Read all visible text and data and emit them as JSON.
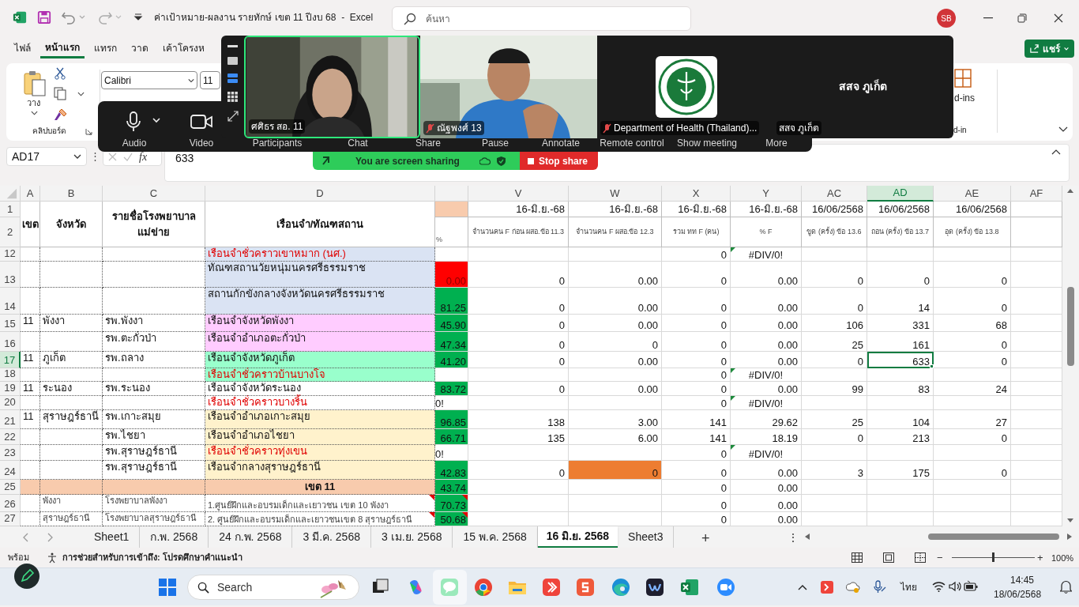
{
  "title_bar": {
    "title": "ค่าเป้าหมาย-ผลงาน รายทักษ์ เขต 11 ปีงบ 68  -  Excel",
    "search_placeholder": "ค้นหา",
    "avatar": "SB"
  },
  "ribbon_tabs": [
    {
      "label": "ไฟล์",
      "selected": false
    },
    {
      "label": "หน้าแรก",
      "selected": true
    },
    {
      "label": "แทรก",
      "selected": false
    },
    {
      "label": "วาด",
      "selected": false
    },
    {
      "label": "เค้าโครงห",
      "selected": false
    }
  ],
  "share_button": "แชร์",
  "ribbon": {
    "paste": "วาง",
    "clipboard_group": "คลิปบอร์ด",
    "font": "Calibri",
    "font_size": "11",
    "addins": "d-ins",
    "addins_group": "d-in"
  },
  "formula_bar": {
    "name_box": "AD17",
    "more": "⋮",
    "fx": "fx",
    "value": "633"
  },
  "sheet": {
    "columns": [
      {
        "letter": "A",
        "selected": false
      },
      {
        "letter": "B",
        "selected": false
      },
      {
        "letter": "C",
        "selected": false
      },
      {
        "letter": "D",
        "selected": false
      },
      {
        "selected": false
      },
      {
        "letter": "V",
        "selected": false
      },
      {
        "letter": "W",
        "selected": false
      },
      {
        "letter": "X",
        "selected": false
      },
      {
        "letter": "Y",
        "selected": false
      },
      {
        "letter": "AC",
        "selected": false
      },
      {
        "letter": "AD",
        "selected": true
      },
      {
        "letter": "AE",
        "selected": false
      },
      {
        "letter": "AF",
        "selected": false
      }
    ],
    "header_rows": [
      "1",
      "2"
    ],
    "left_headers": [
      "เขต",
      "จังหวัด",
      "รายชื่อโรงพยาบาลแม่ข่าย",
      "เรือนจำ/ทัณฑสถาน"
    ],
    "percent_header": {
      "color": "#f8cbad",
      "label": "%"
    },
    "dates": [
      "16-มิ.ย.-68",
      "16-มิ.ย.-68",
      "16-มิ.ย.-68",
      "16-มิ.ย.-68",
      "16/06/2568",
      "16/06/2568",
      "16/06/2568"
    ],
    "labels": [
      "จำนวนคน F ก่อน ผสอ.ข้อ 11.3",
      "จำนวนคน F ผสอ.ข้อ 12.3",
      "รวม ทท F (คน)",
      "% F",
      "ขูด (ครั้ง) ข้อ 13.6",
      "ถอน (ครั้ง) ข้อ 13.7",
      "อุด (ครั้ง) ข้อ 13.8"
    ],
    "rows": [
      {
        "row": "12",
        "kind": "entry",
        "selected": false,
        "prison": "เรือนจำชั่วคราวเขาหมาก (นศ.)",
        "color": "#dae3f3",
        "alert": true,
        "error_flag": true,
        "comment": false,
        "values": [
          {
            "selected": false
          },
          {
            "selected": false
          },
          {
            "text": "0",
            "selected": false
          },
          {
            "text": "#DIV/0!",
            "selected": false
          },
          {
            "selected": false
          },
          {
            "selected": false
          },
          {
            "selected": false
          }
        ]
      },
      {
        "row": "13",
        "kind": "entry",
        "selected": false,
        "prison": "ทัณฑสถานวัยหนุ่มนครศรีธรรมราช",
        "color": "#dae3f3",
        "alert": false,
        "error_flag": false,
        "comment": false,
        "percent": {
          "text": "0.00",
          "color": "#ff0000"
        },
        "values": [
          {
            "text": "0",
            "selected": false
          },
          {
            "text": "0.00",
            "selected": false
          },
          {
            "text": "0",
            "selected": false
          },
          {
            "text": "0.00",
            "selected": false
          },
          {
            "text": "0",
            "selected": false
          },
          {
            "text": "0",
            "selected": false
          },
          {
            "text": "0",
            "selected": false
          }
        ]
      },
      {
        "row": "14",
        "kind": "entry",
        "selected": false,
        "prison": "สถานกักขังกลางจังหวัดนครศรีธรรมราช",
        "color": "#dae3f3",
        "alert": false,
        "error_flag": false,
        "comment": false,
        "percent": {
          "text": "81.25",
          "color": "#00b050"
        },
        "values": [
          {
            "text": "0",
            "selected": false
          },
          {
            "text": "0.00",
            "selected": false
          },
          {
            "text": "0",
            "selected": false
          },
          {
            "text": "0.00",
            "selected": false
          },
          {
            "text": "0",
            "selected": false
          },
          {
            "text": "14",
            "selected": false
          },
          {
            "text": "0",
            "selected": false
          }
        ]
      },
      {
        "row": "15",
        "kind": "entry",
        "selected": false,
        "zone": "11",
        "province": "พังงา",
        "hospital": "รพ.พังงา",
        "prison": "เรือนจำจังหวัดพังงา",
        "color": "#ffccff",
        "alert": false,
        "error_flag": false,
        "comment": false,
        "percent": {
          "text": "45.90",
          "color": "#00b050"
        },
        "values": [
          {
            "text": "0",
            "selected": false
          },
          {
            "text": "0.00",
            "selected": false
          },
          {
            "text": "0",
            "selected": false
          },
          {
            "text": "0.00",
            "selected": false
          },
          {
            "text": "106",
            "selected": false
          },
          {
            "text": "331",
            "selected": false
          },
          {
            "text": "68",
            "selected": false
          }
        ]
      },
      {
        "row": "16",
        "kind": "entry",
        "selected": false,
        "hospital": "รพ.ตะกั่วป่า",
        "prison": "เรือนจำอำเภอตะกั่วป่า",
        "color": "#ffccff",
        "alert": false,
        "error_flag": false,
        "comment": false,
        "percent": {
          "text": "47.34",
          "color": "#00b050"
        },
        "values": [
          {
            "text": "0",
            "selected": false
          },
          {
            "text": "0",
            "selected": false
          },
          {
            "text": "0",
            "selected": false
          },
          {
            "text": "0.00",
            "selected": false
          },
          {
            "text": "25",
            "selected": false
          },
          {
            "text": "161",
            "selected": false
          },
          {
            "text": "0",
            "selected": false
          }
        ]
      },
      {
        "row": "17",
        "kind": "entry",
        "selected": true,
        "zone": "11",
        "province": "ภูเก็ต",
        "hospital": "รพ.ถลาง",
        "prison": "เรือนจำจังหวัดภูเก็ต",
        "color": "#99ffcc",
        "alert": false,
        "error_flag": false,
        "comment": false,
        "percent": {
          "text": "41.20",
          "color": "#00b050"
        },
        "values": [
          {
            "text": "0",
            "selected": false
          },
          {
            "text": "0.00",
            "selected": false
          },
          {
            "text": "0",
            "selected": false
          },
          {
            "text": "0.00",
            "selected": false
          },
          {
            "text": "0",
            "selected": false
          },
          {
            "text": "633",
            "selected": true
          },
          {
            "text": "0",
            "selected": false
          }
        ]
      },
      {
        "row": "18",
        "kind": "entry",
        "selected": false,
        "prison": "เรือนจำชั่วคราวบ้านบางโจ",
        "color": "#99ffcc",
        "alert": true,
        "error_flag": true,
        "comment": false,
        "values": [
          {
            "selected": false
          },
          {
            "selected": false
          },
          {
            "text": "0",
            "selected": false
          },
          {
            "text": "#DIV/0!",
            "selected": false
          },
          {
            "selected": false
          },
          {
            "selected": false
          },
          {
            "selected": false
          }
        ]
      },
      {
        "row": "19",
        "kind": "entry",
        "selected": false,
        "zone": "11",
        "province": "ระนอง",
        "hospital": "รพ.ระนอง",
        "prison": "เรือนจำจังหวัดระนอง",
        "color": "#ffffff",
        "alert": false,
        "error_flag": false,
        "comment": false,
        "percent": {
          "text": "83.72",
          "color": "#00b050"
        },
        "values": [
          {
            "text": "0",
            "selected": false
          },
          {
            "text": "0.00",
            "selected": false
          },
          {
            "text": "0",
            "selected": false
          },
          {
            "text": "0.00",
            "selected": false
          },
          {
            "text": "99",
            "selected": false
          },
          {
            "text": "83",
            "selected": false
          },
          {
            "text": "24",
            "selected": false
          }
        ]
      },
      {
        "row": "20",
        "kind": "entry",
        "selected": false,
        "prison": "เรือนจำชั่วคราวบางริ้น",
        "color": "#ffffff",
        "alert": true,
        "error_flag": true,
        "comment": false,
        "percent": {
          "text": "0!"
        },
        "values": [
          {
            "selected": false
          },
          {
            "selected": false
          },
          {
            "text": "0",
            "selected": false
          },
          {
            "text": "#DIV/0!",
            "selected": false
          },
          {
            "selected": false
          },
          {
            "selected": false
          },
          {
            "selected": false
          }
        ]
      },
      {
        "row": "21",
        "kind": "entry",
        "selected": false,
        "zone": "11",
        "province": "สุราษฎร์ธานี",
        "hospital": "รพ.เกาะสมุย",
        "prison": "เรือนจำอำเภอเกาะสมุย",
        "color": "#fff2cc",
        "alert": false,
        "error_flag": false,
        "comment": false,
        "percent": {
          "text": "96.85",
          "color": "#00b050"
        },
        "values": [
          {
            "text": "138",
            "selected": false
          },
          {
            "text": "3.00",
            "selected": false
          },
          {
            "text": "141",
            "selected": false
          },
          {
            "text": "29.62",
            "selected": false
          },
          {
            "text": "25",
            "selected": false
          },
          {
            "text": "104",
            "selected": false
          },
          {
            "text": "27",
            "selected": false
          }
        ]
      },
      {
        "row": "22",
        "kind": "entry",
        "selected": false,
        "hospital": "รพ.ไชยา",
        "prison": "เรือนจำอำเภอไชยา",
        "color": "#fff2cc",
        "alert": false,
        "error_flag": false,
        "comment": false,
        "percent": {
          "text": "66.71",
          "color": "#00b050"
        },
        "values": [
          {
            "text": "135",
            "selected": false
          },
          {
            "text": "6.00",
            "selected": false
          },
          {
            "text": "141",
            "selected": false
          },
          {
            "text": "18.19",
            "selected": false
          },
          {
            "text": "0",
            "selected": false
          },
          {
            "text": "213",
            "selected": false
          },
          {
            "text": "0",
            "selected": false
          }
        ]
      },
      {
        "row": "23",
        "kind": "entry",
        "selected": false,
        "hospital": "รพ.สุราษฎร์ธานี",
        "prison": "เรือนจำชั่วคราวทุ่งเขน",
        "color": "#fff2cc",
        "alert": true,
        "error_flag": true,
        "comment": false,
        "percent": {
          "text": "0!"
        },
        "values": [
          {
            "selected": false
          },
          {
            "selected": false
          },
          {
            "text": "0",
            "selected": false
          },
          {
            "text": "#DIV/0!",
            "selected": false
          },
          {
            "selected": false
          },
          {
            "selected": false
          },
          {
            "selected": false
          }
        ]
      },
      {
        "row": "24",
        "kind": "entry",
        "selected": false,
        "hospital": "รพ.สุราษฎร์ธานี",
        "prison": "เรือนจำกลางสุราษฎร์ธานี",
        "color": "#fff2cc",
        "alert": false,
        "error_flag": false,
        "comment": false,
        "percent": {
          "text": "42.83",
          "color": "#00b050"
        },
        "values": [
          {
            "text": "0",
            "selected": false
          },
          {
            "text": "0",
            "selected": false,
            "color": "#ed7d31"
          },
          {
            "text": "0",
            "selected": false
          },
          {
            "text": "0.00",
            "selected": false
          },
          {
            "text": "3",
            "selected": false
          },
          {
            "text": "175",
            "selected": false
          },
          {
            "text": "0",
            "selected": false
          }
        ]
      },
      {
        "row": "25",
        "kind": "total",
        "selected": false,
        "prison": "เขต 11",
        "color": "#f8cbad",
        "alert": false,
        "error_flag": false,
        "comment": false,
        "percent": {
          "text": "43.74",
          "color": "#00b050"
        },
        "values": [
          {
            "selected": false
          },
          {
            "selected": false
          },
          {
            "text": "0",
            "selected": false
          },
          {
            "text": "0.00",
            "selected": false
          },
          {
            "selected": false
          },
          {
            "selected": false
          },
          {
            "selected": false
          }
        ]
      },
      {
        "row": "26",
        "kind": "detail",
        "selected": false,
        "province": "พังงา",
        "hospital": "โรงพยาบาลพังงา",
        "prison": "1.ศูนย์ฝึกและอบรมเด็กและเยาวชน เขต 10 พังงา",
        "color": "#ffffff",
        "alert": false,
        "error_flag": false,
        "comment": true,
        "percent": {
          "text": "70.73",
          "color": "#00b050"
        },
        "values": [
          {
            "selected": false
          },
          {
            "selected": false
          },
          {
            "text": "0",
            "selected": false
          },
          {
            "text": "0.00",
            "selected": false
          },
          {
            "selected": false
          },
          {
            "selected": false
          },
          {
            "selected": false
          }
        ]
      },
      {
        "row": "27",
        "kind": "detail",
        "selected": false,
        "province": "สุราษฎร์ธานี",
        "hospital": "โรงพยาบาลสุราษฎร์ธานี",
        "prison": "2. ศูนย์ฝึกและอบรมเด็กและเยาวชนเขต 8 สุราษฎร์ธานี",
        "color": "#ffffff",
        "alert": false,
        "error_flag": false,
        "comment": true,
        "percent": {
          "text": "50.68",
          "color": "#00b050"
        },
        "values": [
          {
            "selected": false
          },
          {
            "selected": false
          },
          {
            "text": "0",
            "selected": false
          },
          {
            "text": "0.00",
            "selected": false
          },
          {
            "selected": false
          },
          {
            "selected": false
          },
          {
            "selected": false
          }
        ]
      }
    ]
  },
  "sheet_tabs": [
    {
      "label": "Sheet1",
      "selected": false
    },
    {
      "label": "ก.พ. 2568",
      "selected": false
    },
    {
      "label": "24 ก.พ. 2568",
      "selected": false
    },
    {
      "label": "3 มี.ค. 2568",
      "selected": false
    },
    {
      "label": "3 เม.ย. 2568",
      "selected": false
    },
    {
      "label": "15 พ.ค. 2568",
      "selected": false
    },
    {
      "label": "16 มิ.ย. 2568",
      "selected": true
    },
    {
      "label": "Sheet3",
      "selected": false
    }
  ],
  "sheet_tab_controls": {
    "add": "+",
    "more": "⋮"
  },
  "status_bar": {
    "ready": "พร้อม",
    "accessibility": "การช่วยสำหรับการเข้าถึง: โปรดศึกษาคำแนะนำ",
    "zoom_out": "−",
    "zoom_in": "+",
    "zoom_slider": {
      "level": 0.5
    },
    "zoom": "100%"
  },
  "zoom_meeting": {
    "tiles": [
      {
        "kind": "video",
        "name": "ศศิธร สอ. 11",
        "muted": false,
        "active": true
      },
      {
        "kind": "video",
        "name": "ณัฐพงศ์ 13",
        "muted": true,
        "active": false
      },
      {
        "kind": "logo",
        "name": "Department of Health (Thailand)...",
        "muted": true,
        "active": false
      },
      {
        "kind": "text",
        "caption": "สสจ ภูเก็ต",
        "name": "สสจ ภูเก็ต",
        "muted": false,
        "active": false
      }
    ],
    "toolbar": [
      "Audio",
      "Video",
      "Participants",
      "Chat",
      "Share",
      "Pause",
      "Annotate",
      "Remote control",
      "Show meeting",
      "More"
    ],
    "sharing_banner": "You are screen sharing",
    "stop_share": "Stop share"
  },
  "taskbar": {
    "search": "Search",
    "language": "ไทย",
    "time": "14:45",
    "date": "18/06/2568"
  }
}
